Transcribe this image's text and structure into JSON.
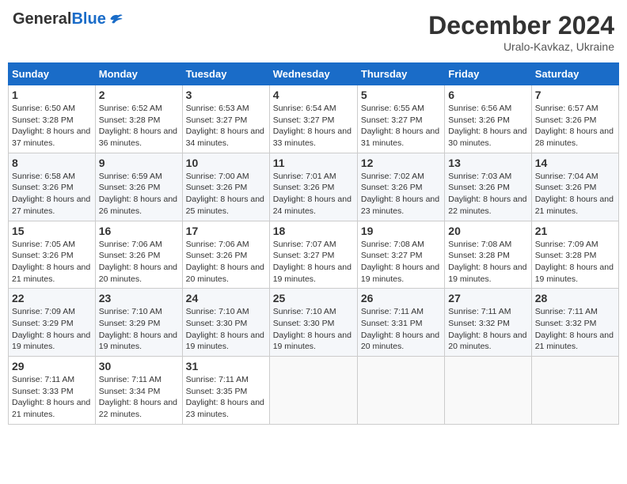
{
  "header": {
    "logo_general": "General",
    "logo_blue": "Blue",
    "month_title": "December 2024",
    "location": "Uralo-Kavkaz, Ukraine"
  },
  "weekdays": [
    "Sunday",
    "Monday",
    "Tuesday",
    "Wednesday",
    "Thursday",
    "Friday",
    "Saturday"
  ],
  "weeks": [
    [
      {
        "day": "1",
        "sunrise": "6:50 AM",
        "sunset": "3:28 PM",
        "daylight": "8 hours and 37 minutes."
      },
      {
        "day": "2",
        "sunrise": "6:52 AM",
        "sunset": "3:28 PM",
        "daylight": "8 hours and 36 minutes."
      },
      {
        "day": "3",
        "sunrise": "6:53 AM",
        "sunset": "3:27 PM",
        "daylight": "8 hours and 34 minutes."
      },
      {
        "day": "4",
        "sunrise": "6:54 AM",
        "sunset": "3:27 PM",
        "daylight": "8 hours and 33 minutes."
      },
      {
        "day": "5",
        "sunrise": "6:55 AM",
        "sunset": "3:27 PM",
        "daylight": "8 hours and 31 minutes."
      },
      {
        "day": "6",
        "sunrise": "6:56 AM",
        "sunset": "3:26 PM",
        "daylight": "8 hours and 30 minutes."
      },
      {
        "day": "7",
        "sunrise": "6:57 AM",
        "sunset": "3:26 PM",
        "daylight": "8 hours and 28 minutes."
      }
    ],
    [
      {
        "day": "8",
        "sunrise": "6:58 AM",
        "sunset": "3:26 PM",
        "daylight": "8 hours and 27 minutes."
      },
      {
        "day": "9",
        "sunrise": "6:59 AM",
        "sunset": "3:26 PM",
        "daylight": "8 hours and 26 minutes."
      },
      {
        "day": "10",
        "sunrise": "7:00 AM",
        "sunset": "3:26 PM",
        "daylight": "8 hours and 25 minutes."
      },
      {
        "day": "11",
        "sunrise": "7:01 AM",
        "sunset": "3:26 PM",
        "daylight": "8 hours and 24 minutes."
      },
      {
        "day": "12",
        "sunrise": "7:02 AM",
        "sunset": "3:26 PM",
        "daylight": "8 hours and 23 minutes."
      },
      {
        "day": "13",
        "sunrise": "7:03 AM",
        "sunset": "3:26 PM",
        "daylight": "8 hours and 22 minutes."
      },
      {
        "day": "14",
        "sunrise": "7:04 AM",
        "sunset": "3:26 PM",
        "daylight": "8 hours and 21 minutes."
      }
    ],
    [
      {
        "day": "15",
        "sunrise": "7:05 AM",
        "sunset": "3:26 PM",
        "daylight": "8 hours and 21 minutes."
      },
      {
        "day": "16",
        "sunrise": "7:06 AM",
        "sunset": "3:26 PM",
        "daylight": "8 hours and 20 minutes."
      },
      {
        "day": "17",
        "sunrise": "7:06 AM",
        "sunset": "3:26 PM",
        "daylight": "8 hours and 20 minutes."
      },
      {
        "day": "18",
        "sunrise": "7:07 AM",
        "sunset": "3:27 PM",
        "daylight": "8 hours and 19 minutes."
      },
      {
        "day": "19",
        "sunrise": "7:08 AM",
        "sunset": "3:27 PM",
        "daylight": "8 hours and 19 minutes."
      },
      {
        "day": "20",
        "sunrise": "7:08 AM",
        "sunset": "3:28 PM",
        "daylight": "8 hours and 19 minutes."
      },
      {
        "day": "21",
        "sunrise": "7:09 AM",
        "sunset": "3:28 PM",
        "daylight": "8 hours and 19 minutes."
      }
    ],
    [
      {
        "day": "22",
        "sunrise": "7:09 AM",
        "sunset": "3:29 PM",
        "daylight": "8 hours and 19 minutes."
      },
      {
        "day": "23",
        "sunrise": "7:10 AM",
        "sunset": "3:29 PM",
        "daylight": "8 hours and 19 minutes."
      },
      {
        "day": "24",
        "sunrise": "7:10 AM",
        "sunset": "3:30 PM",
        "daylight": "8 hours and 19 minutes."
      },
      {
        "day": "25",
        "sunrise": "7:10 AM",
        "sunset": "3:30 PM",
        "daylight": "8 hours and 19 minutes."
      },
      {
        "day": "26",
        "sunrise": "7:11 AM",
        "sunset": "3:31 PM",
        "daylight": "8 hours and 20 minutes."
      },
      {
        "day": "27",
        "sunrise": "7:11 AM",
        "sunset": "3:32 PM",
        "daylight": "8 hours and 20 minutes."
      },
      {
        "day": "28",
        "sunrise": "7:11 AM",
        "sunset": "3:32 PM",
        "daylight": "8 hours and 21 minutes."
      }
    ],
    [
      {
        "day": "29",
        "sunrise": "7:11 AM",
        "sunset": "3:33 PM",
        "daylight": "8 hours and 21 minutes."
      },
      {
        "day": "30",
        "sunrise": "7:11 AM",
        "sunset": "3:34 PM",
        "daylight": "8 hours and 22 minutes."
      },
      {
        "day": "31",
        "sunrise": "7:11 AM",
        "sunset": "3:35 PM",
        "daylight": "8 hours and 23 minutes."
      },
      null,
      null,
      null,
      null
    ]
  ],
  "labels": {
    "sunrise": "Sunrise:",
    "sunset": "Sunset:",
    "daylight": "Daylight:"
  }
}
